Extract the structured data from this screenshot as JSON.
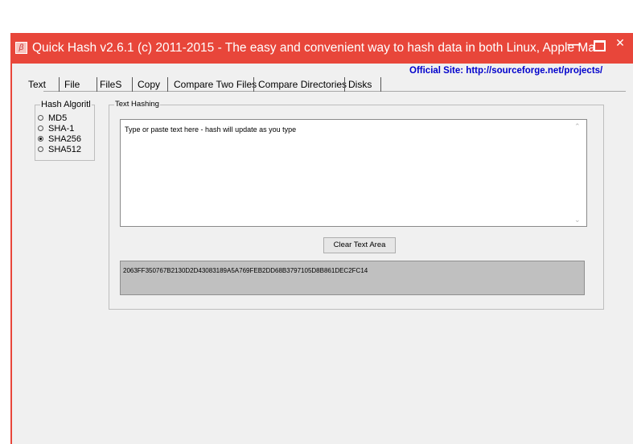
{
  "window": {
    "title": "Quick Hash v2.6.1 (c) 2011-2015 - The easy and convenient way to hash data in both Linux, Apple Ma...",
    "accent_color": "#e8463a",
    "controls": {
      "minimize": "—",
      "close": "✕"
    }
  },
  "site_link": "Official Site: http://sourceforge.net/projects/",
  "tabs": [
    {
      "label": "Text",
      "selected": true
    },
    {
      "label": "File"
    },
    {
      "label": "FileS"
    },
    {
      "label": "Copy"
    },
    {
      "label": "Compare Two Files"
    },
    {
      "label": "Compare Directories"
    },
    {
      "label": "Disks"
    }
  ],
  "hash_algorithm": {
    "title": "Hash Algoritl",
    "options": [
      {
        "label": "MD5",
        "checked": false
      },
      {
        "label": "SHA-1",
        "checked": false
      },
      {
        "label": "SHA256",
        "checked": true
      },
      {
        "label": "SHA512",
        "checked": false
      }
    ]
  },
  "text_hashing": {
    "title": "Text Hashing",
    "input_text": "Type or paste text here - hash will update as you type",
    "clear_button": "Clear Text Area",
    "hash_value": "2063FF350767B2130D2D43083189A5A769FEB2DD68B3797105D8B861DEC2FC14"
  }
}
